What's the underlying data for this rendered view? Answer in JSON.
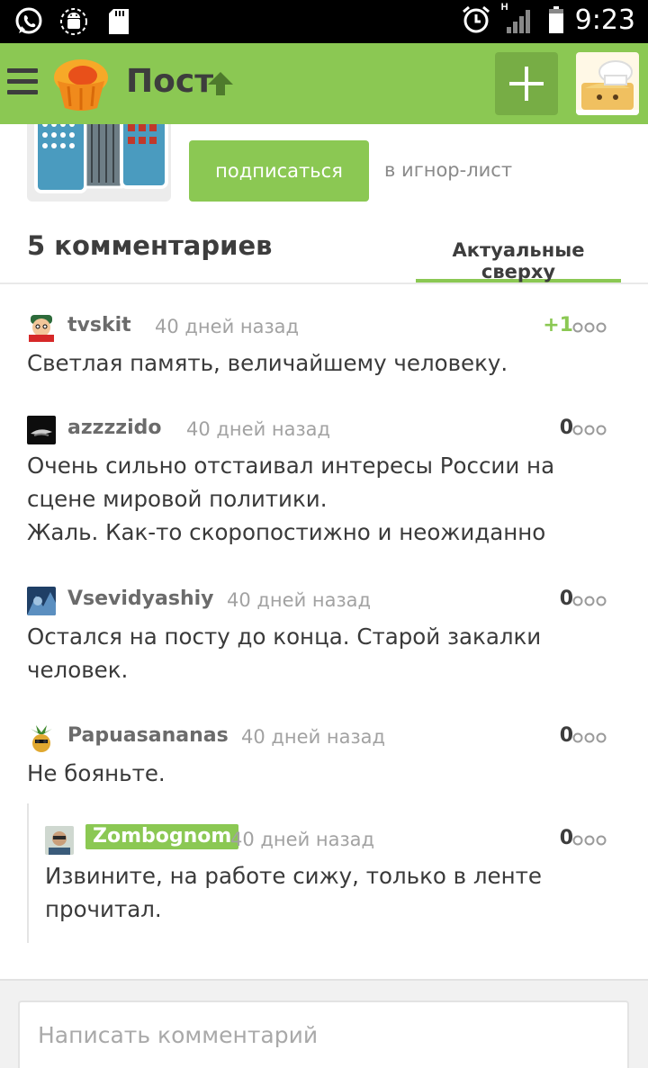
{
  "status_bar": {
    "time": "9:23",
    "network_label": "H",
    "icons": [
      "whatsapp-icon",
      "android-debug-icon",
      "sd-card-icon",
      "alarm-icon",
      "signal-icon",
      "battery-icon"
    ]
  },
  "app_bar": {
    "title": "Пост",
    "icons": [
      "menu-icon",
      "cupcake-logo-icon",
      "arrow-up-icon",
      "plus-icon",
      "chef-avatar-icon"
    ],
    "colors": {
      "primary": "#8bc853",
      "button": "#77ad45"
    }
  },
  "author": {
    "subscribe_label": "подписаться",
    "ignore_label": "в игнор-лист"
  },
  "comments_header": {
    "count_label": "5 комментариев",
    "sort_label": "Актуальные сверху"
  },
  "comments": [
    {
      "user": "tvskit",
      "time": "40 дней назад",
      "rating": "+1",
      "text": "Светлая память, величайшему человеку.",
      "avatar": "cartoon-avatar-icon"
    },
    {
      "user": "azzzzido",
      "time": "40 дней назад",
      "rating": "0",
      "text": "Очень сильно отстаивал интересы России на сцене мировой политики.",
      "text2": "Жаль. Как-то скоропостижно и неожиданно",
      "avatar": "dark-avatar-icon"
    },
    {
      "user": "Vsevidyashiy",
      "time": "40 дней назад",
      "rating": "0",
      "text": "Остался на посту до конца. Старой закалки человек.",
      "avatar": "blue-avatar-icon"
    },
    {
      "user": "Papuasananas",
      "time": "40 дней назад",
      "rating": "0",
      "text": "Не бояньте.",
      "avatar": "pineapple-avatar-icon"
    },
    {
      "user": "Zombognom",
      "time": "40 дней назад",
      "rating": "0",
      "text": "Извините, на работе сижу, только в ленте прочитал.",
      "avatar": "photo-avatar-icon"
    }
  ],
  "footer": {
    "placeholder": "Написать комментарий"
  }
}
